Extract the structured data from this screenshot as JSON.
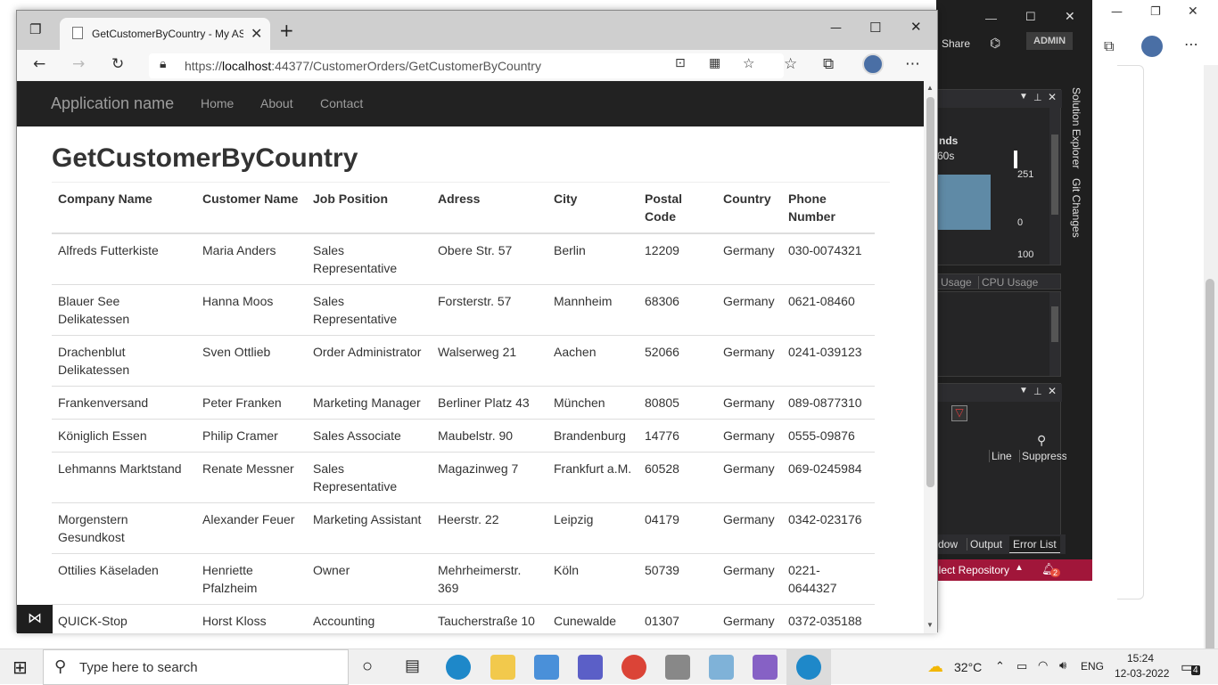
{
  "bg_window": {
    "share_label": "Share",
    "admin_label": "ADMIN"
  },
  "vs": {
    "header_trunc": "nds",
    "time_trunc": "60s",
    "val_top": "251",
    "val_zero": "0",
    "val_100": "100",
    "tab_usage": "Usage",
    "tab_cpu": "CPU Usage",
    "col_line": "Line",
    "col_suppress": "Suppress",
    "tab_window": "dow",
    "tab_output": "Output",
    "tab_errorlist": "Error List",
    "side_solution": "Solution Explorer",
    "side_git": "Git Changes",
    "status_repo": "elect Repository",
    "status_count": "2"
  },
  "browser": {
    "tab_title": "GetCustomerByCountry - My ASP.NET Application",
    "url_prefix": "https://",
    "url_host": "localhost",
    "url_rest": ":44377/CustomerOrders/GetCustomerByCountry"
  },
  "site": {
    "brand": "Application name",
    "nav": [
      "Home",
      "About",
      "Contact"
    ],
    "heading": "GetCustomerByCountry"
  },
  "table": {
    "headers": [
      "Company Name",
      "Customer Name",
      "Job Position",
      "Adress",
      "City",
      "Postal Code",
      "Country",
      "Phone Number"
    ],
    "rows": [
      [
        "Alfreds Futterkiste",
        "Maria Anders",
        "Sales Representative",
        "Obere Str. 57",
        "Berlin",
        "12209",
        "Germany",
        "030-0074321"
      ],
      [
        "Blauer See Delikatessen",
        "Hanna Moos",
        "Sales Representative",
        "Forsterstr. 57",
        "Mannheim",
        "68306",
        "Germany",
        "0621-08460"
      ],
      [
        "Drachenblut Delikatessen",
        "Sven Ottlieb",
        "Order Administrator",
        "Walserweg 21",
        "Aachen",
        "52066",
        "Germany",
        "0241-039123"
      ],
      [
        "Frankenversand",
        "Peter Franken",
        "Marketing Manager",
        "Berliner Platz 43",
        "München",
        "80805",
        "Germany",
        "089-0877310"
      ],
      [
        "Königlich Essen",
        "Philip Cramer",
        "Sales Associate",
        "Maubelstr. 90",
        "Brandenburg",
        "14776",
        "Germany",
        "0555-09876"
      ],
      [
        "Lehmanns Marktstand",
        "Renate Messner",
        "Sales Representative",
        "Magazinweg 7",
        "Frankfurt a.M.",
        "60528",
        "Germany",
        "069-0245984"
      ],
      [
        "Morgenstern Gesundkost",
        "Alexander Feuer",
        "Marketing Assistant",
        "Heerstr. 22",
        "Leipzig",
        "04179",
        "Germany",
        "0342-023176"
      ],
      [
        "Ottilies Käseladen",
        "Henriette Pfalzheim",
        "Owner",
        "Mehrheimerstr. 369",
        "Köln",
        "50739",
        "Germany",
        "0221-0644327"
      ],
      [
        "QUICK-Stop",
        "Horst Kloss",
        "Accounting",
        "Taucherstraße 10",
        "Cunewalde",
        "01307",
        "Germany",
        "0372-035188"
      ]
    ]
  },
  "taskbar": {
    "search_placeholder": "Type here to search",
    "temperature": "32°C",
    "lang": "ENG",
    "time": "15:24",
    "date": "12-03-2022",
    "notif_count": "4"
  }
}
